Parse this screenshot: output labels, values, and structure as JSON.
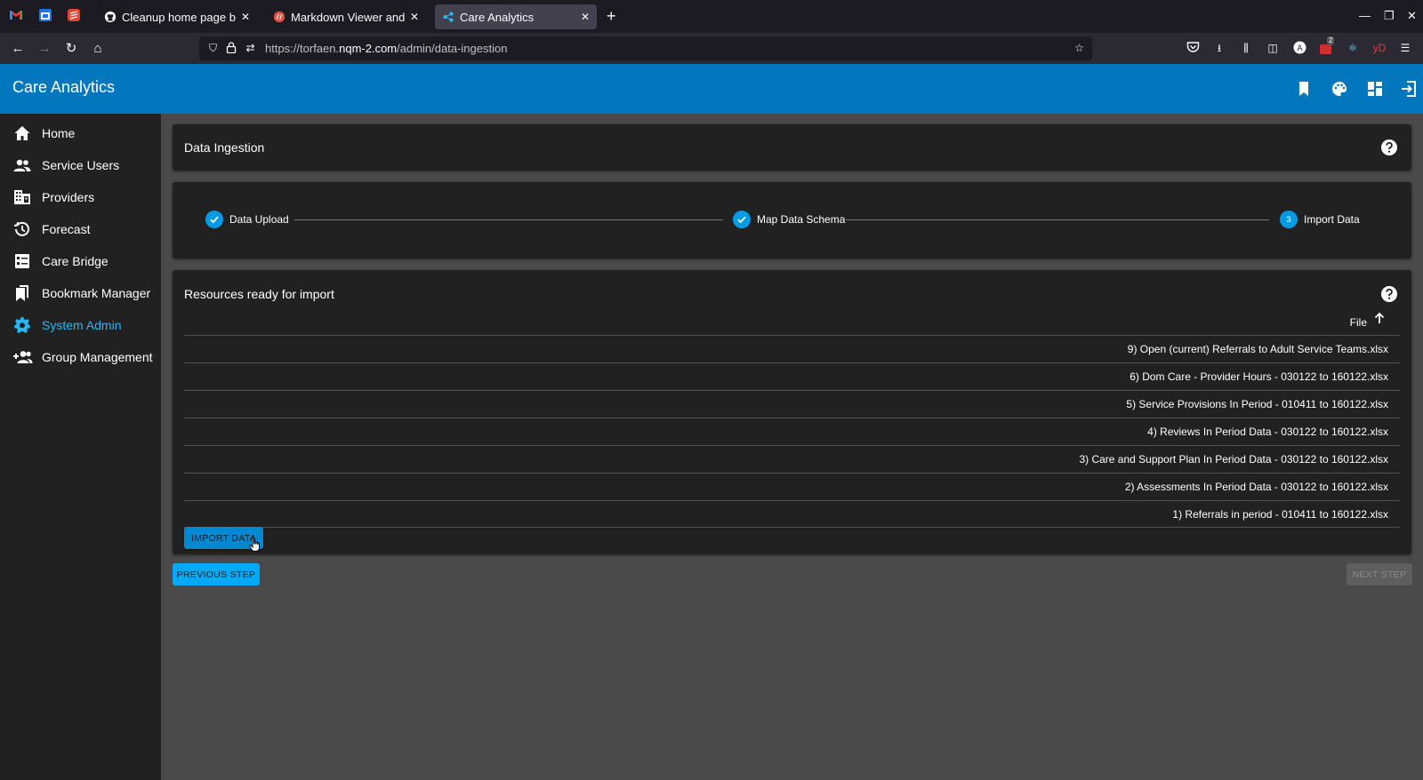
{
  "browser": {
    "tabs": [
      {
        "title": "Cleanup home page by a"
      },
      {
        "title": "Markdown Viewer and Ed"
      },
      {
        "title": "Care Analytics"
      }
    ],
    "url_prefix": "https://torfaen.",
    "url_domain": "nqm-2.com",
    "url_path": "/admin/data-ingestion",
    "extension_badge": "2",
    "extension_yd": "yD"
  },
  "app": {
    "title": "Care Analytics",
    "brand_color": "#0277bd"
  },
  "sidebar": {
    "items": [
      {
        "label": "Home",
        "icon": "home-icon"
      },
      {
        "label": "Service Users",
        "icon": "people-icon"
      },
      {
        "label": "Providers",
        "icon": "building-icon"
      },
      {
        "label": "Forecast",
        "icon": "history-icon"
      },
      {
        "label": "Care Bridge",
        "icon": "list-icon"
      },
      {
        "label": "Bookmark Manager",
        "icon": "bookmarks-icon"
      },
      {
        "label": "System Admin",
        "icon": "gear-icon",
        "active": true
      },
      {
        "label": "Group Management",
        "icon": "group-add-icon"
      }
    ]
  },
  "page": {
    "title": "Data Ingestion"
  },
  "stepper": {
    "steps": [
      {
        "label": "Data Upload",
        "state": "complete"
      },
      {
        "label": "Map Data Schema",
        "state": "complete"
      },
      {
        "label": "Import Data",
        "state": "active",
        "number": "3"
      }
    ]
  },
  "resources": {
    "title": "Resources ready for import",
    "column_header": "File",
    "files": [
      "9) Open (current) Referrals to Adult Service Teams.xlsx",
      "6) Dom Care - Provider Hours - 030122 to 160122.xlsx",
      "5) Service Provisions In Period - 010411 to 160122.xlsx",
      "4) Reviews In Period Data - 030122 to 160122.xlsx",
      "3) Care and Support Plan In Period Data - 030122 to 160122.xlsx",
      "2) Assessments In Period Data - 030122 to 160122.xlsx",
      "1) Referrals in period - 010411 to 160122.xlsx"
    ],
    "import_button": "IMPORT DATA"
  },
  "footer": {
    "previous_button": "PREVIOUS STEP",
    "next_button": "NEXT STEP"
  }
}
